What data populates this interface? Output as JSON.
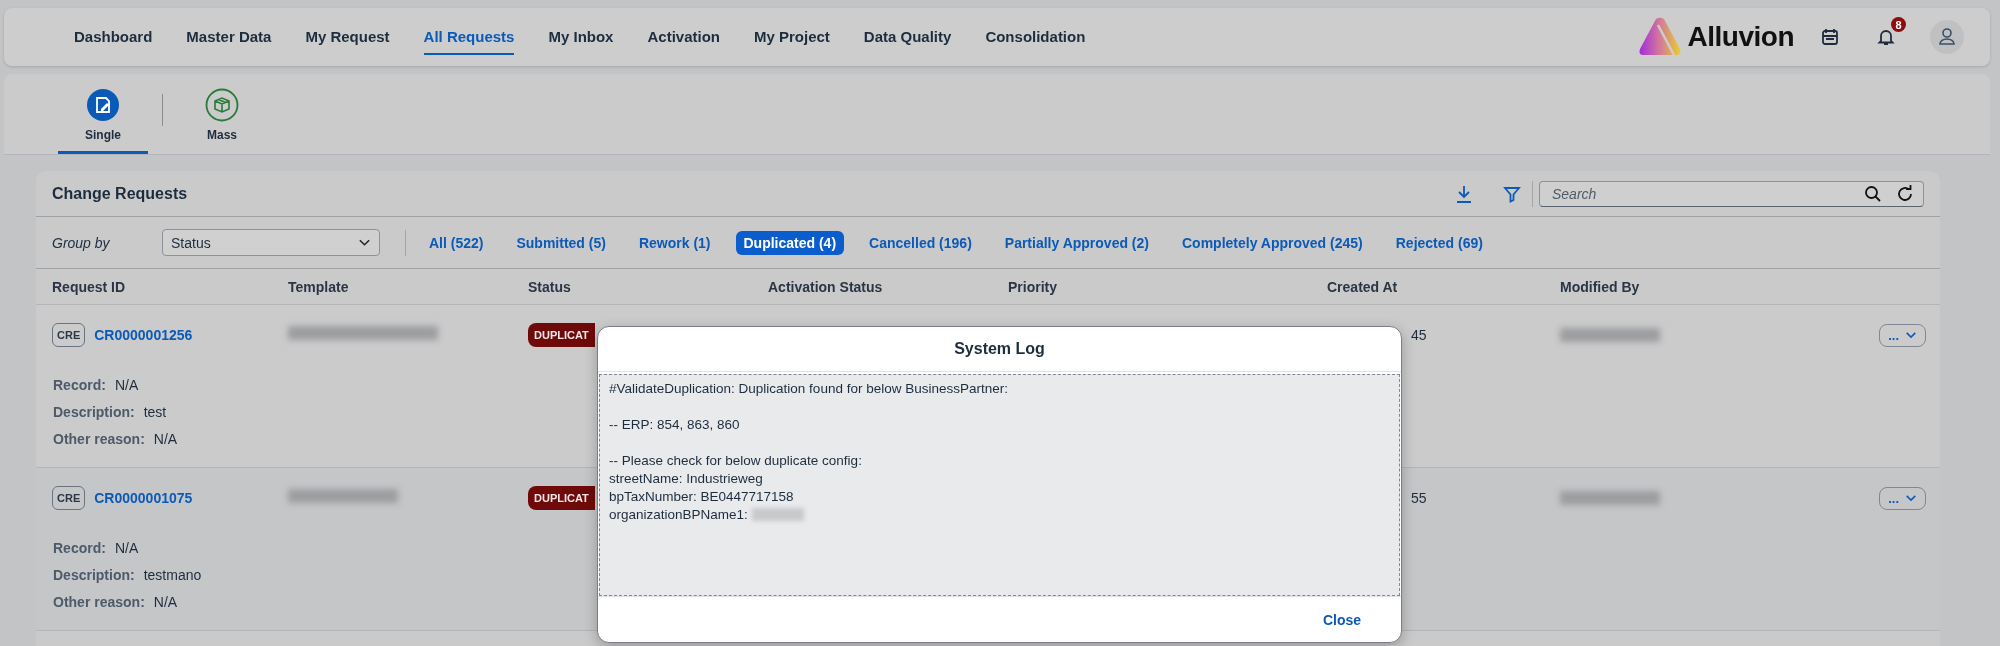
{
  "nav": {
    "items": [
      {
        "label": "Dashboard",
        "selected": false
      },
      {
        "label": "Master Data",
        "selected": false
      },
      {
        "label": "My Request",
        "selected": false
      },
      {
        "label": "All Requests",
        "selected": true
      },
      {
        "label": "My Inbox",
        "selected": false
      },
      {
        "label": "Activation",
        "selected": false
      },
      {
        "label": "My Project",
        "selected": false
      },
      {
        "label": "Data Quality",
        "selected": false
      },
      {
        "label": "Consolidation",
        "selected": false
      }
    ],
    "logo": "Alluvion",
    "notification_count": "8"
  },
  "mode_tabs": [
    {
      "label": "Single",
      "kind": "single",
      "selected": true
    },
    {
      "label": "Mass",
      "kind": "mass",
      "selected": false
    }
  ],
  "panel": {
    "title": "Change Requests",
    "search": {
      "placeholder": "Search"
    },
    "group_by": {
      "label": "Group by",
      "value": "Status"
    },
    "filters": [
      {
        "label": "All (522)",
        "selected": false
      },
      {
        "label": "Submitted (5)",
        "selected": false
      },
      {
        "label": "Rework (1)",
        "selected": false
      },
      {
        "label": "Duplicated (4)",
        "selected": true
      },
      {
        "label": "Cancelled (196)",
        "selected": false
      },
      {
        "label": "Partially Approved (2)",
        "selected": false
      },
      {
        "label": "Completely Approved (245)",
        "selected": false
      },
      {
        "label": "Rejected (69)",
        "selected": false
      }
    ],
    "columns": [
      "Request ID",
      "Template",
      "Status",
      "Activation Status",
      "Priority",
      "Created At",
      "Modified By"
    ],
    "rows": [
      {
        "type": "CRE",
        "id": "CR0000001256",
        "status": "DUPLICAT",
        "created_at": "45",
        "actions": "...",
        "details": [
          {
            "label": "Record:",
            "value": "N/A"
          },
          {
            "label": "Description:",
            "value": "test"
          },
          {
            "label": "Other reason:",
            "value": "N/A"
          }
        ]
      },
      {
        "type": "CRE",
        "id": "CR0000001075",
        "status": "DUPLICAT",
        "created_at": "55",
        "actions": "...",
        "details": [
          {
            "label": "Record:",
            "value": "N/A"
          },
          {
            "label": "Description:",
            "value": "testmano"
          },
          {
            "label": "Other reason:",
            "value": "N/A"
          }
        ]
      }
    ]
  },
  "dialog": {
    "title": "System Log",
    "paragraphs": [
      [
        "#ValidateDuplication: Duplication found for below BusinessPartner:"
      ],
      [
        "-- ERP: 854, 863, 860"
      ],
      [
        "-- Please check for below duplicate config:",
        "streetName: Industrieweg",
        "bpTaxNumber: BE0447717158",
        "organizationBPName1:"
      ]
    ],
    "close": "Close"
  }
}
